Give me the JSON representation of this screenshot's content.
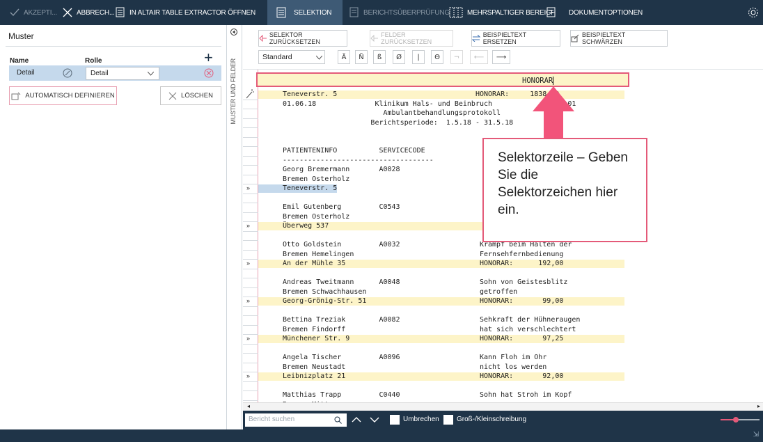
{
  "topbar": {
    "accept": "AKZEPTI...",
    "cancel": "ABBRECH...",
    "open_altair": "IN ALTAIR TABLE EXTRACTOR ÖFFNEN",
    "tabs": [
      "SELEKTION",
      "BERICHTSÜBERPRÜFUNG",
      "MEHRSPALTIGER BEREICH",
      "DOKUMENTOPTIONEN"
    ]
  },
  "left": {
    "title": "Muster",
    "col_name": "Name",
    "col_role": "Rolle",
    "row_name": "Detail",
    "row_role": "Detail",
    "auto_define": "AUTOMATISCH DEFINIEREN",
    "delete": "LÖSCHEN",
    "side_label": "MUSTER UND FELDER"
  },
  "toolbar": {
    "reset_selector": "SELEKTOR ZURÜCKSETZEN",
    "reset_fields": "FELDER ZURÜCKSETZEN",
    "replace_sample": "BEISPIELTEXT ERSETZEN",
    "blacken_sample": "BEISPIELTEXT SCHWÄRZEN",
    "dropdown_value": "Standard",
    "symbols": [
      "Ä",
      "Ñ",
      "ß",
      "Ø",
      "|",
      "Θ",
      "¬",
      "⟵",
      "⟶"
    ]
  },
  "selector": {
    "text": "HONORAR"
  },
  "report": {
    "lines": [
      "Teneverstr. 5                                 HONORAR:     1838,39",
      "01.06.18              Klinikum Hals- und Beinbruch            Seite 01",
      "                        Ambulantbehandlungsprotokoll",
      "                     Berichtsperiode:  1.5.18 - 31.5.18",
      "",
      "",
      "PATIENTENINFO          SERVICECODE",
      "------------------------------------",
      "Georg Bremermann       A0028",
      "Bremen Osterholz",
      "Teneverstr. 5",
      "",
      "Emil Gutenberg         C0543",
      "Bremen Osterholz",
      "Überweg 537",
      "",
      "Otto Goldstein         A0032                   Krampf beim Halten der",
      "Bremen Hemelingen                              Fernsehfernbedienung",
      "An der Mühle 35                                HONORAR:      192,00",
      "",
      "Andreas Tweitmann      A0048                   Sohn von Geistesblitz",
      "Bremen Schwachhausen                           getroffen",
      "Georg-Grönig-Str. 51                           HONORAR:       99,00",
      "",
      "Bettina Treziak        A0082                   Sehkraft der Hühneraugen",
      "Bremen Findorff                                hat sich verschlechtert",
      "Münchener Str. 9                               HONORAR:       97,25",
      "",
      "Angela Tischer         A0096                   Kann Floh im Ohr",
      "Bremen Neustadt                                nicht los werden",
      "Leibnizplatz 21                                HONORAR:       92,00",
      "",
      "Matthias Trapp         C0440                   Sohn hat Stroh im Kopf",
      "Bremen Mitte"
    ]
  },
  "callout": {
    "text": "Selektorzeile – Geben Sie die Selektorzeichen hier ein."
  },
  "search": {
    "placeholder": "Bericht suchen",
    "wrap": "Umbrechen",
    "case": "Groß-/Kleinschreibung"
  },
  "colors": {
    "navy": "#1f3448",
    "highlight_yellow": "#fdf4c8",
    "highlight_blue": "#c5d9ec",
    "accent_pink": "#e45a79"
  }
}
